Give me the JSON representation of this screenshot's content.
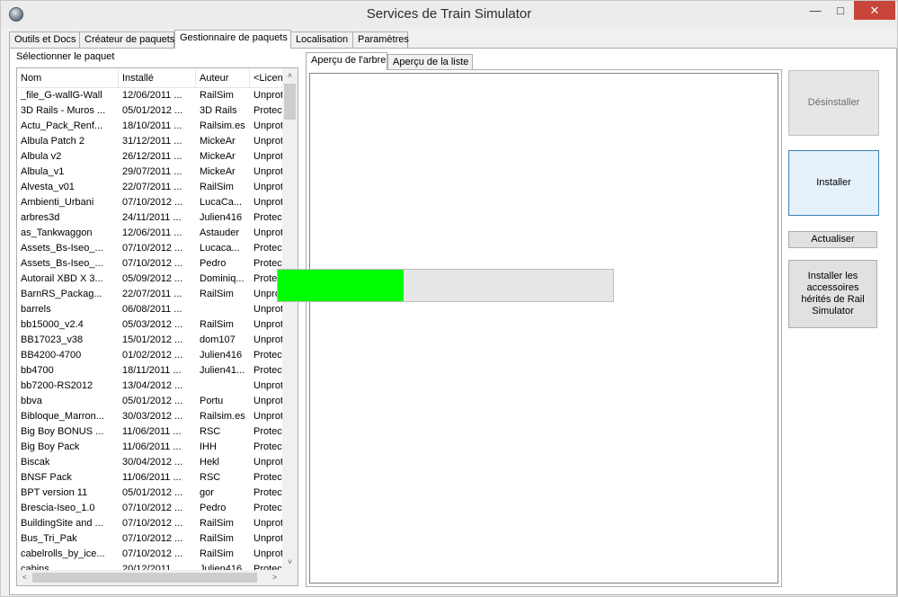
{
  "window": {
    "title": "Services de Train Simulator",
    "min_glyph": "—",
    "max_glyph": "□",
    "close_glyph": "✕"
  },
  "tabs": [
    {
      "label": "Outils et Docs",
      "active": false
    },
    {
      "label": "Créateur de paquets",
      "active": false
    },
    {
      "label": "Gestionnaire de paquets",
      "active": true
    },
    {
      "label": "Localisation",
      "active": false
    },
    {
      "label": "Paramètres",
      "active": false
    }
  ],
  "list": {
    "label": "Sélectionner le paquet",
    "columns": [
      "Nom",
      "Installé",
      "Auteur",
      "<Licenc..."
    ],
    "rows": [
      [
        "_file_G-wallG-Wall",
        "12/06/2011 ...",
        "RailSim",
        "Unprote..."
      ],
      [
        "3D Rails - Muros ...",
        "05/01/2012 ...",
        "3D Rails",
        "Protected"
      ],
      [
        "Actu_Pack_Renf...",
        "18/10/2011 ...",
        "Railsim.es",
        "Unprote..."
      ],
      [
        "Albula Patch 2",
        "31/12/2011 ...",
        "MickeAr",
        "Unprote..."
      ],
      [
        "Albula v2",
        "26/12/2011 ...",
        "MickeAr",
        "Unprote..."
      ],
      [
        "Albula_v1",
        "29/07/2011 ...",
        "MickeAr",
        "Unprote..."
      ],
      [
        "Alvesta_v01",
        "22/07/2011 ...",
        "RailSim",
        "Unprote..."
      ],
      [
        "Ambienti_Urbani",
        "07/10/2012 ...",
        "LucaCa...",
        "Unprote..."
      ],
      [
        "arbres3d",
        "24/11/2011 ...",
        "Julien416",
        "Protected"
      ],
      [
        "as_Tankwaggon",
        "12/06/2011 ...",
        "Astauder",
        "Unprote..."
      ],
      [
        "Assets_Bs-Iseo_...",
        "07/10/2012 ...",
        "Lucaca...",
        "Protected"
      ],
      [
        "Assets_Bs-Iseo_...",
        "07/10/2012 ...",
        "Pedro",
        "Protected"
      ],
      [
        "Autorail XBD X 3...",
        "05/09/2012 ...",
        "Dominiq...",
        "Protected"
      ],
      [
        "BarnRS_Packag...",
        "22/07/2011 ...",
        "RailSim",
        "Unprote..."
      ],
      [
        "barrels",
        "06/08/2011 ...",
        "",
        "Unprote..."
      ],
      [
        "bb15000_v2.4",
        "05/03/2012 ...",
        "RailSim",
        "Unprote..."
      ],
      [
        "BB17023_v38",
        "15/01/2012 ...",
        "dom107",
        "Unprote..."
      ],
      [
        "BB4200-4700",
        "01/02/2012 ...",
        "Julien416",
        "Protected"
      ],
      [
        "bb4700",
        "18/11/2011 ...",
        "Julien41...",
        "Protected"
      ],
      [
        "bb7200-RS2012",
        "13/04/2012 ...",
        "",
        "Unprote..."
      ],
      [
        "bbva",
        "05/01/2012 ...",
        "Portu",
        "Unprote..."
      ],
      [
        "Bibloque_Marron...",
        "30/03/2012 ...",
        "Railsim.es",
        "Unprote..."
      ],
      [
        "Big Boy BONUS ...",
        "11/06/2011 ...",
        "RSC",
        "Protected"
      ],
      [
        "Big Boy Pack",
        "11/06/2011 ...",
        "IHH",
        "Protected"
      ],
      [
        "Biscak",
        "30/04/2012 ...",
        "Hekl",
        "Unprote..."
      ],
      [
        "BNSF Pack",
        "11/06/2011 ...",
        "RSC",
        "Protected"
      ],
      [
        "BPT version 11",
        "05/01/2012 ...",
        "gor",
        "Protected"
      ],
      [
        "Brescia-Iseo_1.0",
        "07/10/2012 ...",
        "Pedro",
        "Protected"
      ],
      [
        "BuildingSite and ...",
        "07/10/2012 ...",
        "RailSim",
        "Unprote..."
      ],
      [
        "Bus_Tri_Pak",
        "07/10/2012 ...",
        "RailSim",
        "Unprote..."
      ],
      [
        "cabelrolls_by_ice...",
        "07/10/2012 ...",
        "RailSim",
        "Unprote..."
      ],
      [
        "cabins",
        "20/12/2011 ...",
        "Julien416",
        "Protected"
      ]
    ]
  },
  "preview_tabs": [
    {
      "label": "Aperçu de l'arbre",
      "active": true
    },
    {
      "label": "Aperçu de la liste",
      "active": false
    }
  ],
  "progress": {
    "value": 0.375
  },
  "actions": {
    "uninstall": "Désinstaller",
    "install": "Installer",
    "refresh": "Actualiser",
    "install_legacy": "Installer les accessoires hérités de Rail Simulator"
  },
  "icons": {
    "scroll_up": "˄",
    "scroll_down": "˅",
    "scroll_left": "˂",
    "scroll_right": "˃"
  },
  "colors": {
    "progress_fill": "#00ff00",
    "close_button": "#c7453b"
  }
}
